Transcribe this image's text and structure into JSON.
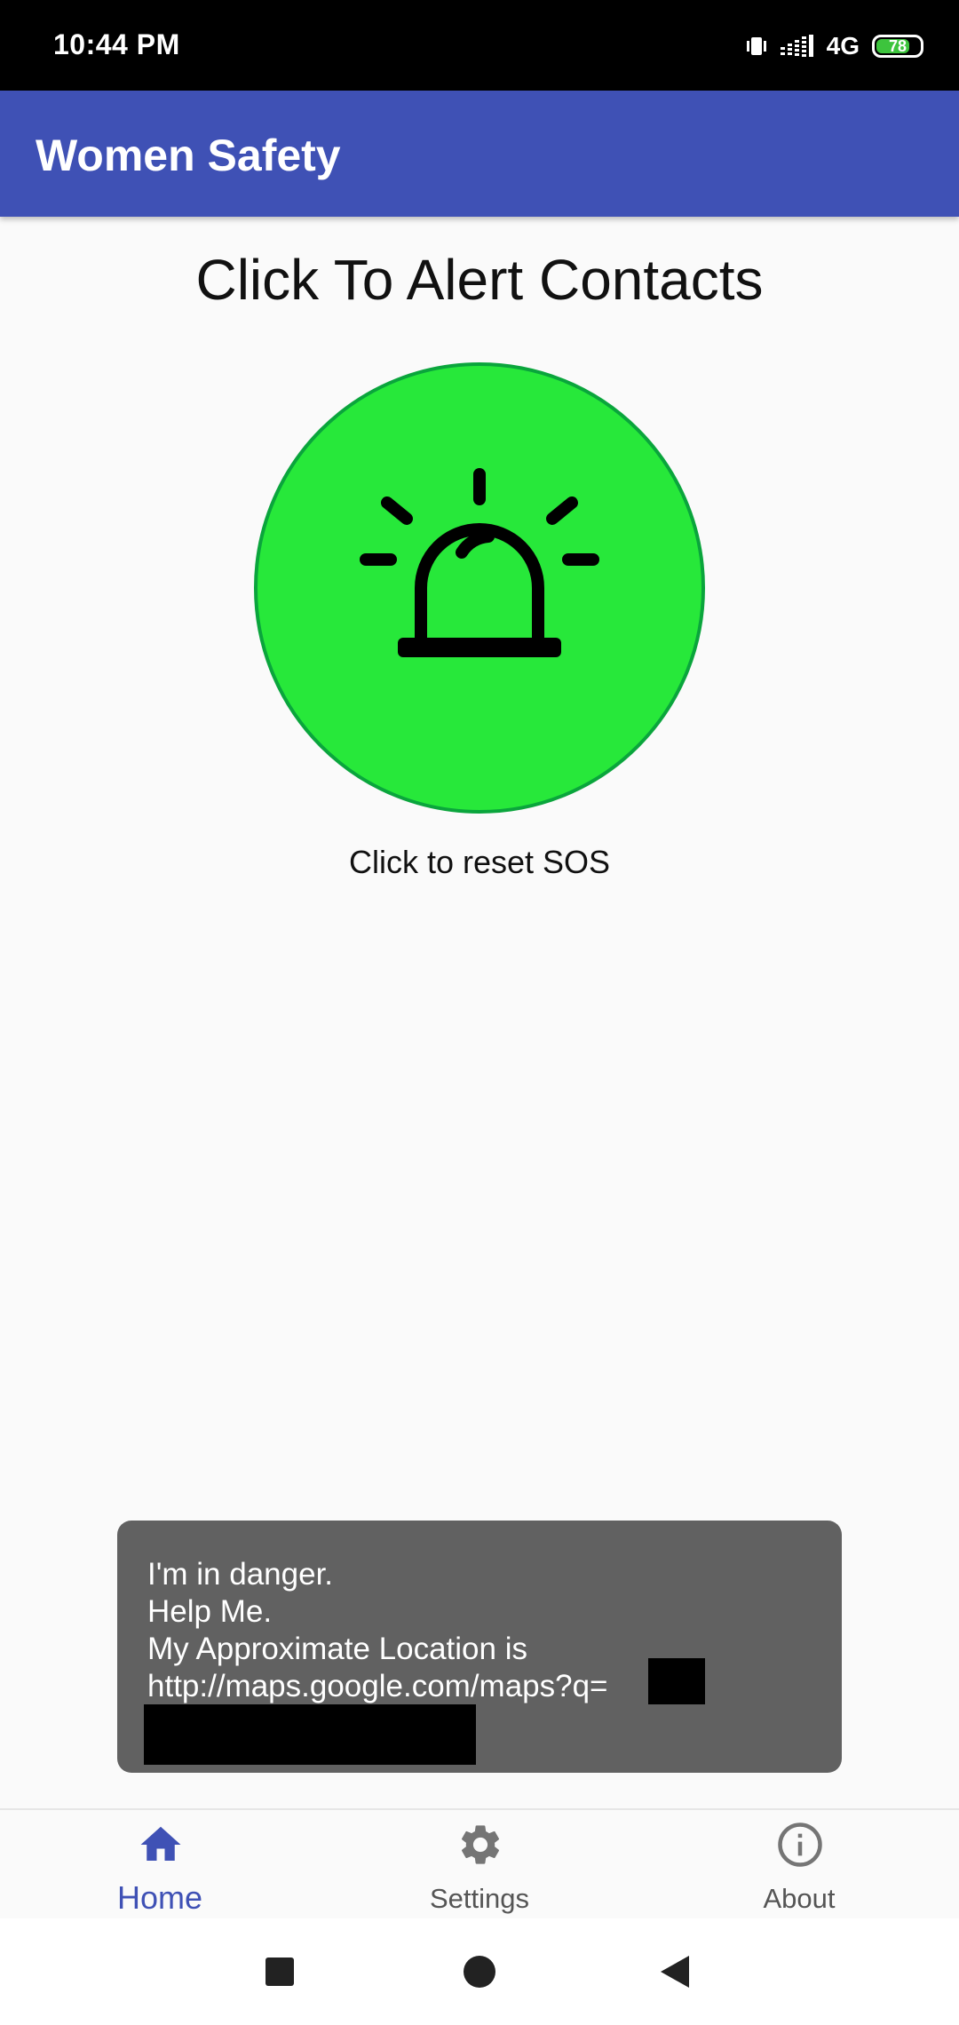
{
  "status_bar": {
    "time": "10:44 PM",
    "network": "4G",
    "battery_percent": 78,
    "battery_label": "78"
  },
  "app_bar": {
    "title": "Women Safety"
  },
  "main": {
    "heading": "Click To Alert Contacts",
    "sos_button_icon": "siren-icon",
    "sos_button_color": "#27e83a",
    "reset_label": "Click to reset SOS"
  },
  "toast": {
    "lines": [
      "I'm in danger.",
      "Help Me.",
      "My Approximate Location is",
      " http://maps.google.com/maps?q="
    ]
  },
  "bottom_nav": {
    "items": [
      {
        "label": "Home",
        "icon": "home-icon",
        "active": true
      },
      {
        "label": "Settings",
        "icon": "gear-icon",
        "active": false
      },
      {
        "label": "About",
        "icon": "info-icon",
        "active": false
      }
    ]
  },
  "colors": {
    "primary": "#3f51b5",
    "sos_green": "#27e83a",
    "toast_bg": "#616161"
  }
}
